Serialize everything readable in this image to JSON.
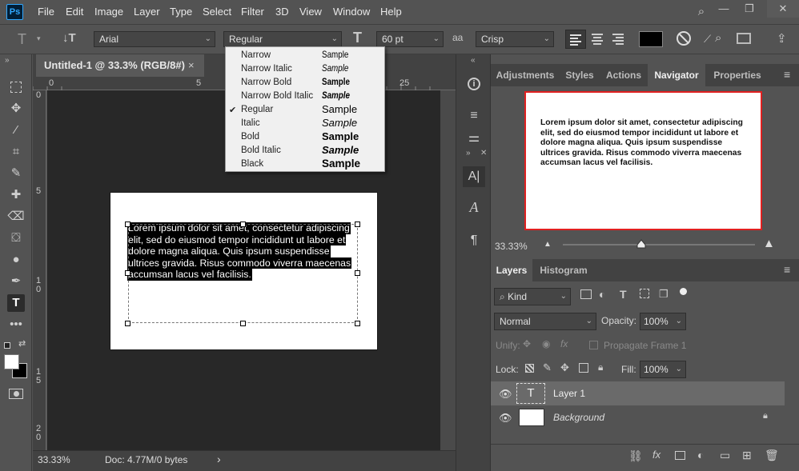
{
  "app": {
    "logo": "Ps"
  },
  "menu": [
    "File",
    "Edit",
    "Image",
    "Layer",
    "Type",
    "Select",
    "Filter",
    "3D",
    "View",
    "Window",
    "Help"
  ],
  "window_controls": {
    "search": "⌕",
    "minimize": "—",
    "restore": "❐",
    "close": "✕"
  },
  "options": {
    "tool_icon": "T",
    "orient_icon": "↓T",
    "font_family": "Arial",
    "font_style": "Regular",
    "size_icon": "T",
    "font_size": "60 pt",
    "aa_icon": "aa",
    "antialias": "Crisp"
  },
  "font_style_menu": [
    {
      "name": "Narrow",
      "sample": "Sample",
      "checked": false
    },
    {
      "name": "Narrow Italic",
      "sample": "Sample",
      "checked": false
    },
    {
      "name": "Narrow Bold",
      "sample": "Sample",
      "checked": false
    },
    {
      "name": "Narrow Bold Italic",
      "sample": "Sample",
      "checked": false
    },
    {
      "name": "Regular",
      "sample": "Sample",
      "checked": true
    },
    {
      "name": "Italic",
      "sample": "Sample",
      "checked": false
    },
    {
      "name": "Bold",
      "sample": "Sample",
      "checked": false
    },
    {
      "name": "Bold Italic",
      "sample": "Sample",
      "checked": false
    },
    {
      "name": "Black",
      "sample": "Sample",
      "checked": false
    }
  ],
  "check_mark": "✔",
  "document": {
    "tab_title": "Untitled-1 @ 33.3% (RGB/8#)",
    "tab_close": "×",
    "ruler_h": [
      "0",
      "5",
      "20",
      "25"
    ],
    "ruler_v": [
      "0",
      "5",
      "1",
      "0",
      "1",
      "5",
      "2",
      "0"
    ],
    "text_lines": [
      "Lorem ipsum dolor sit amet, consectetur adipiscing",
      "elit, sed do eiusmod tempor incididunt ut labore et",
      "dolore magna aliqua. Quis ipsum suspendisse",
      "ultrices gravida. Risus commodo viverra maecenas",
      "accumsan lacus vel facilisis."
    ]
  },
  "status": {
    "zoom": "33.33%",
    "doc": "Doc: 4.77M/0 bytes",
    "arrow": "›"
  },
  "panel_tabs_top": [
    "Adjustments",
    "Styles",
    "Actions",
    "Navigator",
    "Properties"
  ],
  "panel_menu_icon": "≡",
  "navigator": {
    "zoom": "33.33%",
    "text_lines": [
      "Lorem ipsum dolor sit amet, consectetur adipiscing",
      "elit, sed do eiusmod tempor incididunt ut labore et",
      "dolore magna aliqua. Quis ipsum suspendisse",
      "ultrices gravida. Risus commodo viverra maecenas",
      "accumsan lacus vel facilisis."
    ],
    "zoom_level": 0.4
  },
  "layers_panel": {
    "tabs": [
      "Layers",
      "Histogram"
    ],
    "filter_kind": "Kind",
    "blend_mode": "Normal",
    "opacity_label": "Opacity:",
    "opacity": "100%",
    "unify_label": "Unify:",
    "propagate_label": "Propagate Frame 1",
    "lock_label": "Lock:",
    "fill_label": "Fill:",
    "fill": "100%",
    "layers": [
      {
        "name": "Layer 1",
        "thumb": "T",
        "selected": true,
        "italic": false
      },
      {
        "name": "Background",
        "thumb": "",
        "selected": false,
        "italic": true
      }
    ]
  },
  "colors": {
    "bg": "#535353",
    "canvas": "#282828",
    "selected_layer": "#6a6a6a",
    "navigator_border": "#e02020"
  }
}
